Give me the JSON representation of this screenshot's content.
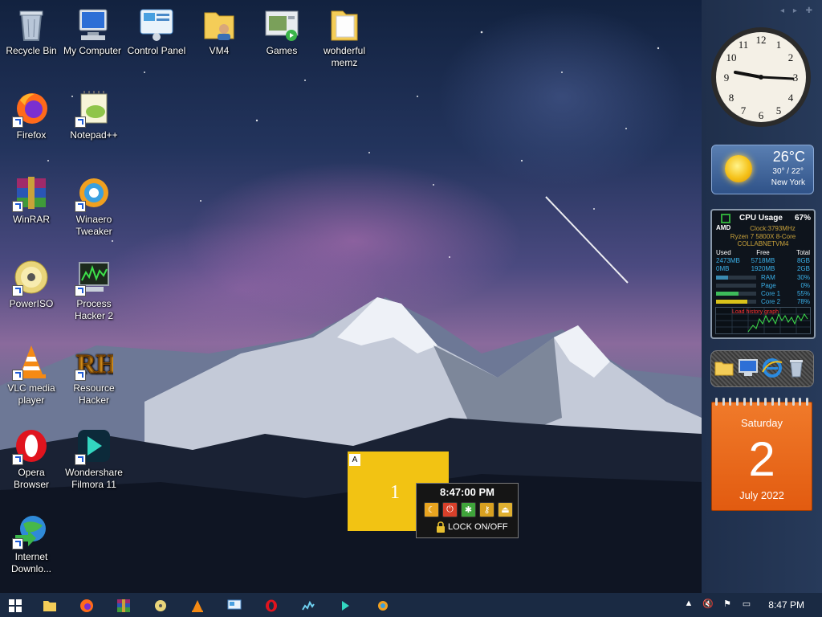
{
  "desktop_icons": [
    {
      "id": "recycle-bin",
      "label": "Recycle Bin"
    },
    {
      "id": "my-computer",
      "label": "My Computer"
    },
    {
      "id": "control-panel",
      "label": "Control Panel"
    },
    {
      "id": "vm4",
      "label": "VM4"
    },
    {
      "id": "games",
      "label": "Games"
    },
    {
      "id": "wonderful-memz",
      "label": "wonderful memz"
    },
    {
      "id": "firefox",
      "label": "Firefox"
    },
    {
      "id": "notepad-plus-plus",
      "label": "Notepad++"
    },
    {
      "id": "winrar",
      "label": "WinRAR"
    },
    {
      "id": "winaero-tweaker",
      "label": "Winaero Tweaker"
    },
    {
      "id": "poweriso",
      "label": "PowerISO"
    },
    {
      "id": "process-hacker",
      "label": "Process Hacker 2"
    },
    {
      "id": "vlc",
      "label": "VLC media player"
    },
    {
      "id": "resource-hacker",
      "label": "Resource Hacker"
    },
    {
      "id": "opera",
      "label": "Opera Browser"
    },
    {
      "id": "filmora",
      "label": "Wondershare Filmora 11"
    },
    {
      "id": "internet-download",
      "label": "Internet Downlo..."
    }
  ],
  "weather": {
    "temp": "26°C",
    "range": "30° / 22°",
    "city": "New York"
  },
  "cpu": {
    "brand": "AMD",
    "title": "CPU Usage",
    "percent": "67%",
    "clock": "Clock:3793MHz",
    "model": "Ryzen 7 5800X 8-Core",
    "host": "COLLABNETVM4",
    "headers": [
      "Used",
      "Free",
      "Total"
    ],
    "mem_rows": [
      [
        "2473MB",
        "5718MB",
        "8GB"
      ],
      [
        "0MB",
        "1920MB",
        "2GB"
      ]
    ],
    "bars": [
      {
        "name": "RAM",
        "value": "30%",
        "fraction": 0.3,
        "color": "#3a8ab0"
      },
      {
        "name": "Page",
        "value": "0%",
        "fraction": 0.0,
        "color": "#3a8ab0"
      },
      {
        "name": "Core 1",
        "value": "55%",
        "fraction": 0.55,
        "color": "#3dbb5a"
      },
      {
        "name": "Core 2",
        "value": "78%",
        "fraction": 0.78,
        "color": "#d9c21a"
      }
    ],
    "graph_label": "Load history graph"
  },
  "calendar": {
    "day": "Saturday",
    "date": "2",
    "month": "July 2022"
  },
  "desk_switcher": {
    "tag": "A",
    "number": "1"
  },
  "lock_gadget": {
    "time": "8:47:00 PM",
    "label": "LOCK ON/OFF"
  },
  "taskbar": {
    "time": "8:47 PM"
  },
  "colors": {
    "taskbar": "#1a2a43",
    "calendar": "#e25b10",
    "switcher": "#f2c313"
  }
}
